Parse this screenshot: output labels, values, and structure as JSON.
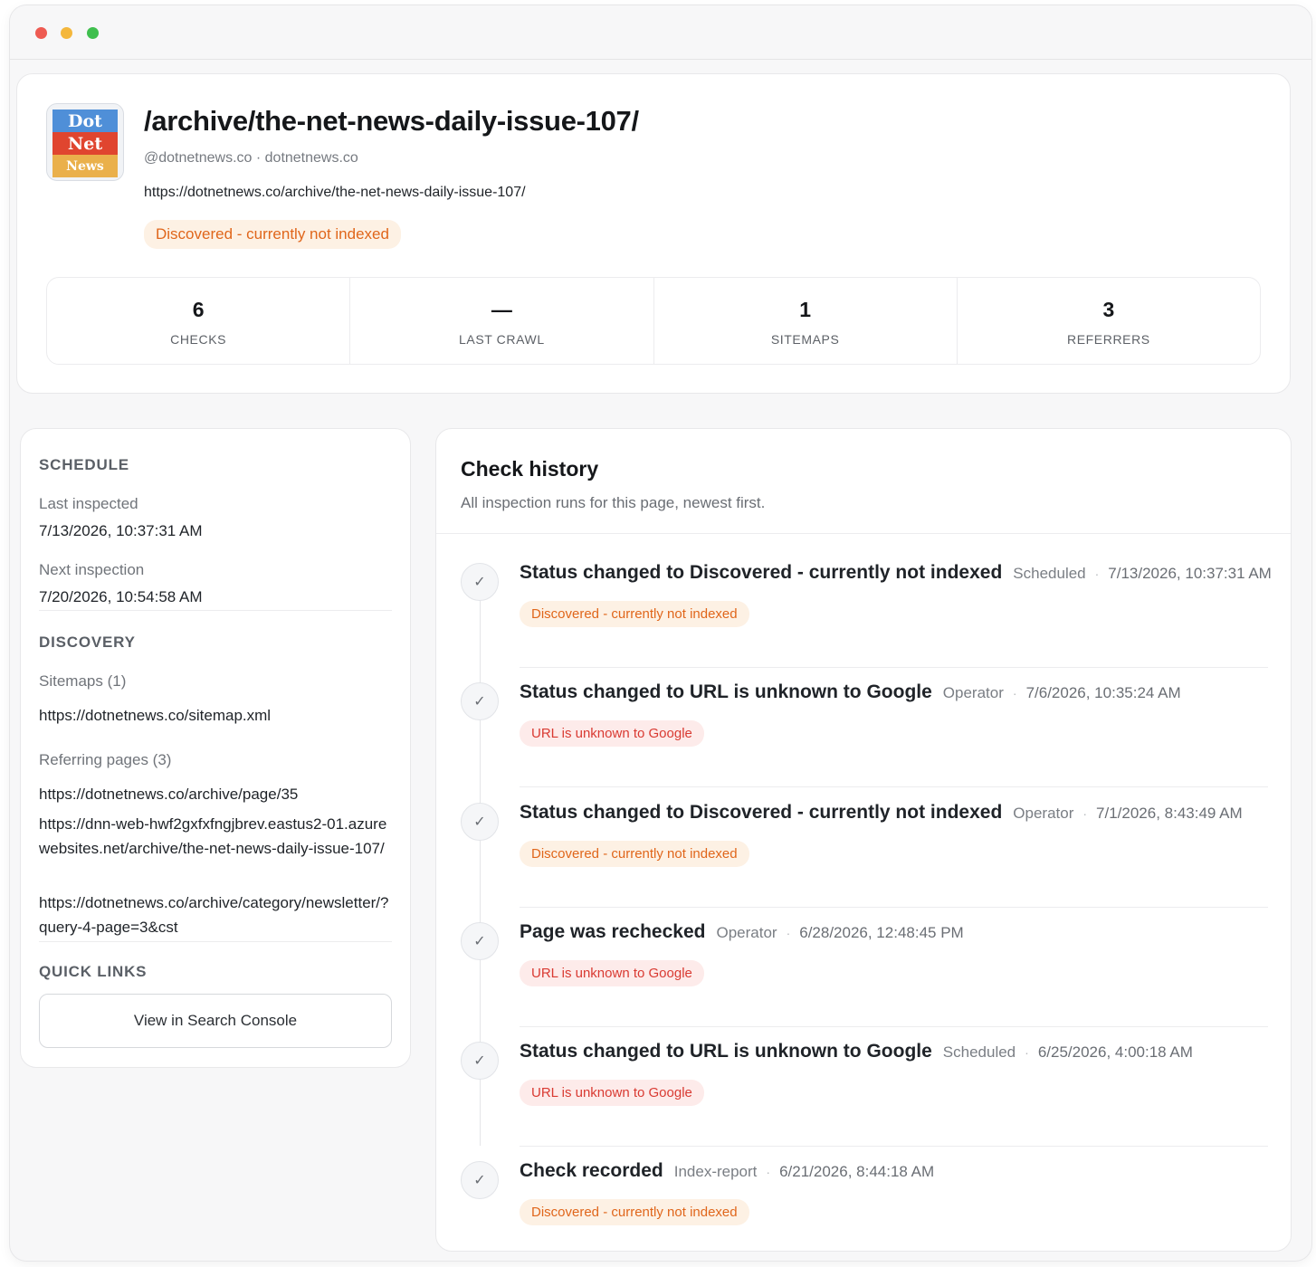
{
  "page": {
    "title": "/archive/the-net-news-daily-issue-107/",
    "handle": "@dotnetnews.co · dotnetnews.co",
    "url": "https://dotnetnews.co/archive/the-net-news-daily-issue-107/",
    "status": "Discovered - currently not indexed",
    "logo": {
      "line1": "Dot",
      "line2": "Net",
      "line3": "News"
    }
  },
  "stats": [
    {
      "value": "6",
      "label": "CHECKS"
    },
    {
      "value": "—",
      "label": "LAST CRAWL"
    },
    {
      "value": "1",
      "label": "SITEMAPS"
    },
    {
      "value": "3",
      "label": "REFERRERS"
    }
  ],
  "sidebar": {
    "schedule_title": "SCHEDULE",
    "last_inspected_label": "Last inspected",
    "last_inspected_value": "7/13/2026, 10:37:31 AM",
    "next_inspection_label": "Next inspection",
    "next_inspection_value": "7/20/2026, 10:54:58 AM",
    "discovery_title": "DISCOVERY",
    "sitemaps_label": "Sitemaps (1)",
    "sitemaps": [
      "https://dotnetnews.co/sitemap.xml"
    ],
    "referring_label": "Referring pages (3)",
    "referring": [
      "https://dotnetnews.co/archive/page/35",
      "https://dnn-web-hwf2gxfxfngjbrev.eastus2-01.azurewebsites.net/archive/the-net-news-daily-issue-107/",
      "https://dotnetnews.co/archive/category/newsletter/?query-4-page=3&cst"
    ],
    "quick_links_title": "QUICK LINKS",
    "search_console_button": "View in Search Console"
  },
  "history": {
    "title": "Check history",
    "subtitle": "All inspection runs for this page, newest first.",
    "entries": [
      {
        "title": "Status changed to Discovered - currently not indexed",
        "actor": "Scheduled",
        "time": "7/13/2026, 10:37:31 AM",
        "badge": "Discovered - currently not indexed",
        "badge_tone": "orange"
      },
      {
        "title": "Status changed to URL is unknown to Google",
        "actor": "Operator",
        "time": "7/6/2026, 10:35:24 AM",
        "badge": "URL is unknown to Google",
        "badge_tone": "red"
      },
      {
        "title": "Status changed to Discovered - currently not indexed",
        "actor": "Operator",
        "time": "7/1/2026, 8:43:49 AM",
        "badge": "Discovered - currently not indexed",
        "badge_tone": "orange"
      },
      {
        "title": "Page was rechecked",
        "actor": "Operator",
        "time": "6/28/2026, 12:48:45 PM",
        "badge": "URL is unknown to Google",
        "badge_tone": "red"
      },
      {
        "title": "Status changed to URL is unknown to Google",
        "actor": "Scheduled",
        "time": "6/25/2026, 4:00:18 AM",
        "badge": "URL is unknown to Google",
        "badge_tone": "red"
      },
      {
        "title": "Check recorded",
        "actor": "Index-report",
        "time": "6/21/2026, 8:44:18 AM",
        "badge": "Discovered - currently not indexed",
        "badge_tone": "orange"
      }
    ]
  },
  "colors": {
    "orange_badge_bg": "#fdf1e4",
    "orange_badge_text": "#e0661b",
    "red_badge_bg": "#fdebea",
    "red_badge_text": "#d93a32"
  }
}
